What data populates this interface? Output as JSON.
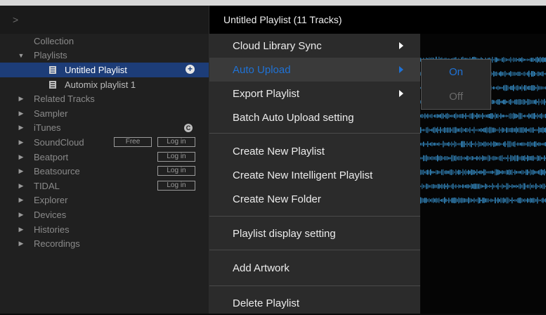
{
  "browser": {
    "header_glyph": ">",
    "tree": [
      {
        "label": "Collection",
        "arrow": ""
      },
      {
        "label": "Playlists",
        "arrow": "▼"
      },
      {
        "label": "Untitled Playlist",
        "arrow": "",
        "selected": true
      },
      {
        "label": "Automix playlist 1",
        "arrow": ""
      },
      {
        "label": "Related Tracks",
        "arrow": "▶"
      },
      {
        "label": "Sampler",
        "arrow": "▶"
      },
      {
        "label": "iTunes",
        "arrow": "▶"
      },
      {
        "label": "SoundCloud",
        "arrow": "▶"
      },
      {
        "label": "Beatport",
        "arrow": "▶"
      },
      {
        "label": "Beatsource",
        "arrow": "▶"
      },
      {
        "label": "TIDAL",
        "arrow": "▶"
      },
      {
        "label": "Explorer",
        "arrow": "▶"
      },
      {
        "label": "Devices",
        "arrow": "▶"
      },
      {
        "label": "Histories",
        "arrow": "▶"
      },
      {
        "label": "Recordings",
        "arrow": "▶"
      }
    ],
    "add_icon": "+",
    "itunes_icon": "C",
    "free_label": "Free",
    "login_label": "Log in"
  },
  "main": {
    "title": "Untitled Playlist (11 Tracks)"
  },
  "context_menu": {
    "items": [
      {
        "label": "Cloud Library Sync",
        "has_submenu": true
      },
      {
        "label": "Auto Upload",
        "has_submenu": true,
        "highlighted": true
      },
      {
        "label": "Export Playlist",
        "has_submenu": true
      },
      {
        "label": "Batch Auto Upload setting"
      },
      {
        "label": "Create New Playlist"
      },
      {
        "label": "Create New Intelligent Playlist"
      },
      {
        "label": "Create New Folder"
      },
      {
        "label": "Playlist display setting"
      },
      {
        "label": "Add Artwork"
      },
      {
        "label": "Delete Playlist"
      }
    ],
    "highlight_color": "#1f72d6"
  },
  "submenu": {
    "on_label": "On",
    "off_label": "Off"
  },
  "colors": {
    "selection": "#1d3d78",
    "waveform": "#3a9ad9"
  }
}
